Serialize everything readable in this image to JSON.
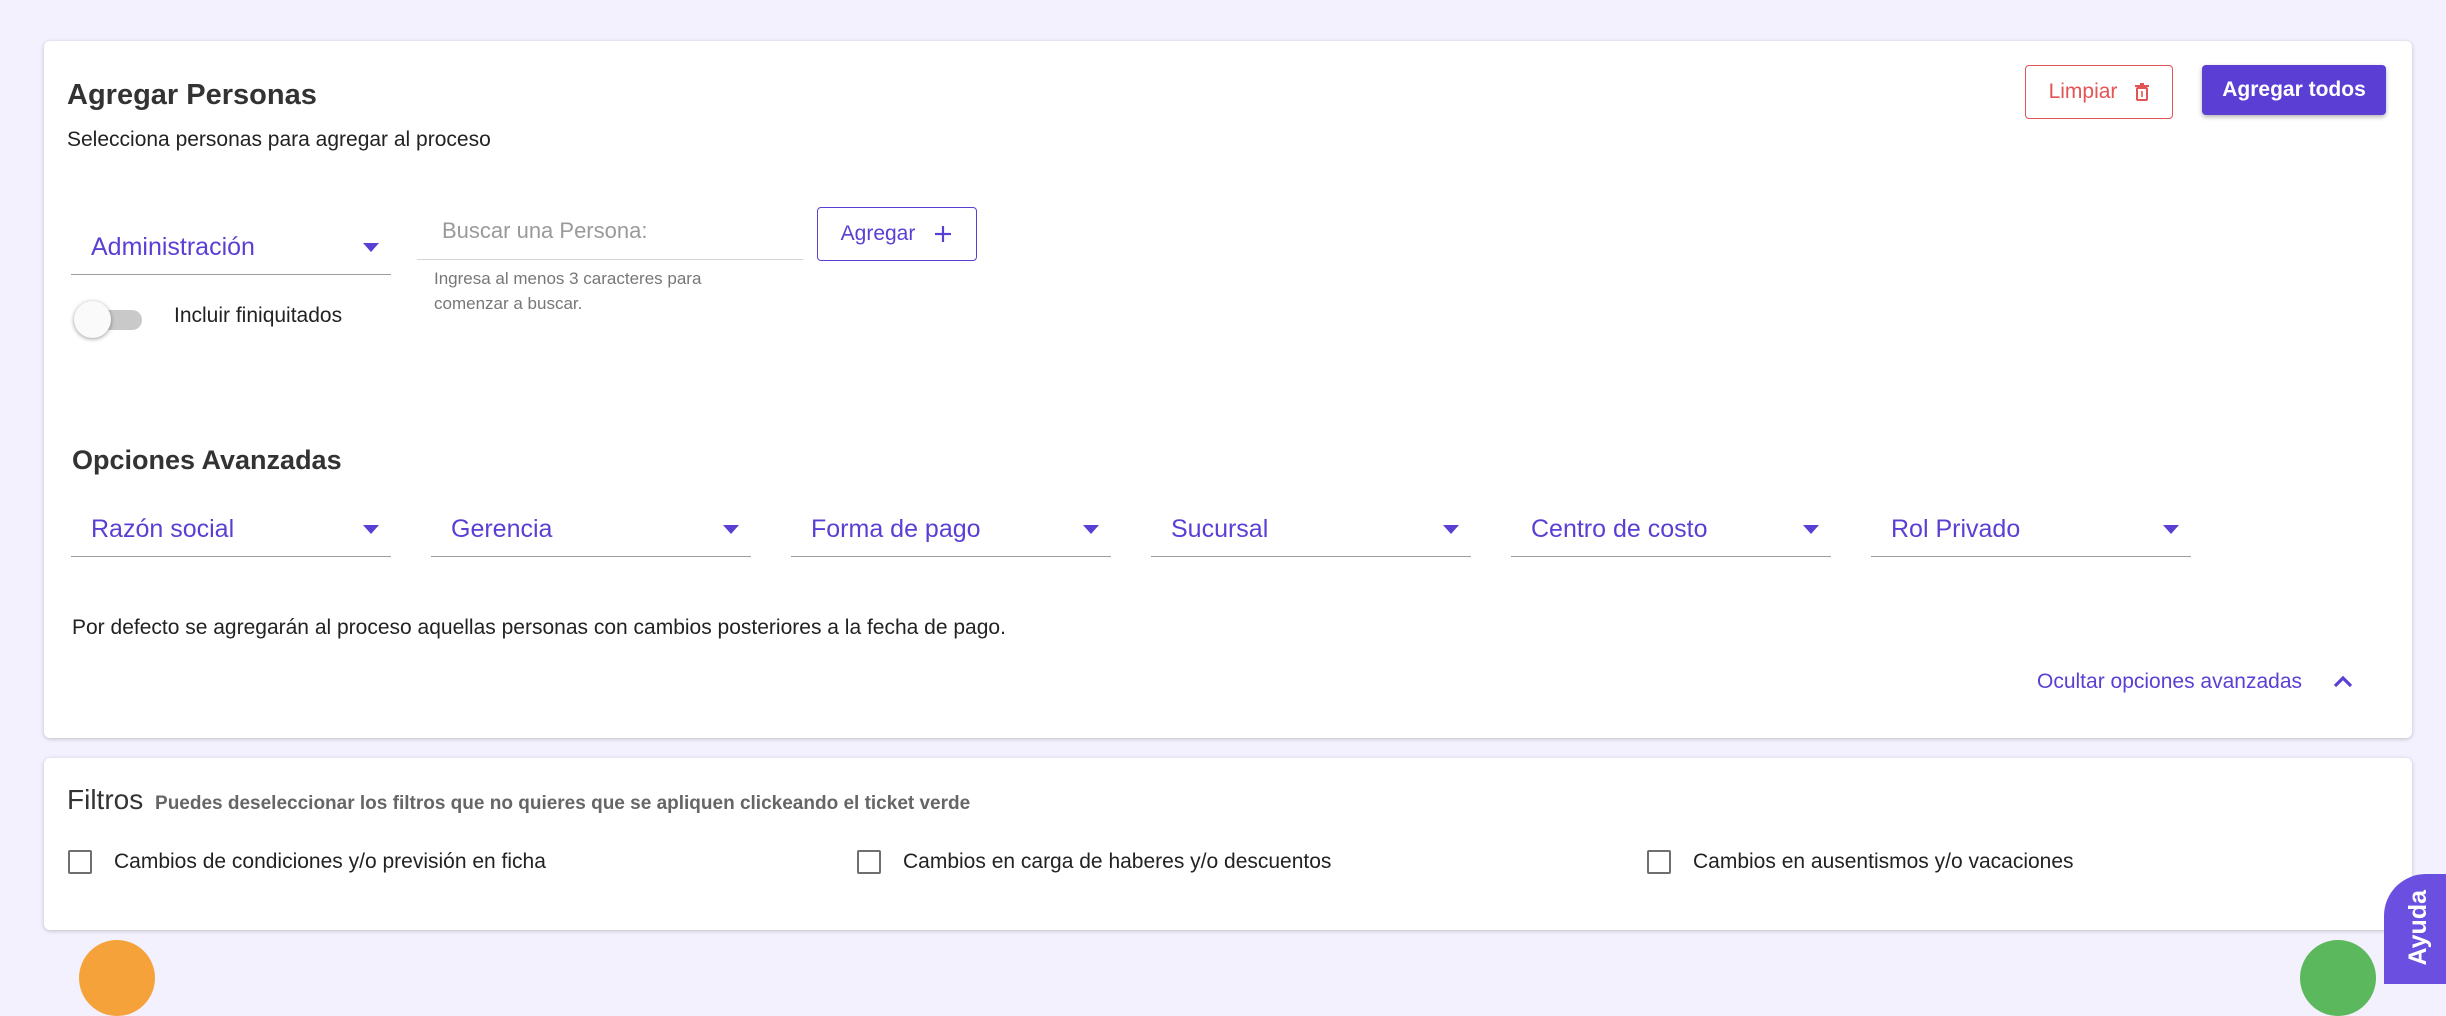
{
  "header": {
    "title": "Agregar Personas",
    "subtitle": "Selecciona personas para agregar al proceso",
    "clear_label": "Limpiar",
    "add_all_label": "Agregar todos"
  },
  "selector": {
    "area_value": "Administración",
    "search_placeholder": "Buscar una Persona:",
    "search_value": "",
    "search_hint": "Ingresa al menos 3 caracteres para comenzar a buscar.",
    "add_label": "Agregar",
    "toggle_label": "Incluir finiquitados",
    "toggle_on": false
  },
  "advanced": {
    "title": "Opciones Avanzadas",
    "selects": [
      "Razón social",
      "Gerencia",
      "Forma de pago",
      "Sucursal",
      "Centro de costo",
      "Rol Privado"
    ],
    "note": "Por defecto se agregarán al proceso aquellas personas con cambios posteriores a la fecha de pago.",
    "hide_label": "Ocultar opciones avanzadas"
  },
  "filtros": {
    "title": "Filtros",
    "subtitle": "Puedes deseleccionar los filtros que no quieres que se apliquen clickeando el ticket verde",
    "items": [
      {
        "label": "Cambios de condiciones y/o previsión en ficha",
        "checked": false
      },
      {
        "label": "Cambios en carga de haberes y/o descuentos",
        "checked": false
      },
      {
        "label": "Cambios en ausentismos y/o vacaciones",
        "checked": false
      }
    ]
  },
  "help": {
    "label": "Ayuda"
  },
  "colors": {
    "accent": "#5b3fd4",
    "danger": "#e35454",
    "background": "#f3f1fd"
  }
}
